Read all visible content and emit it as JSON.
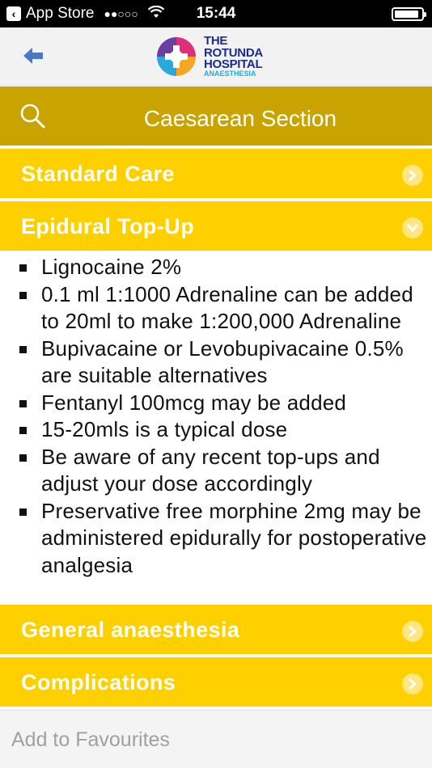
{
  "status_bar": {
    "back_app": "App Store",
    "signal": "●●○○○",
    "time": "15:44",
    "battery_level": 0.9
  },
  "nav": {
    "logo_line1": "THE",
    "logo_line2": "ROTUNDA",
    "logo_line3": "HOSPITAL",
    "logo_sub": "ANAESTHESIA"
  },
  "header": {
    "title": "Caesarean Section"
  },
  "sections": [
    {
      "title": "Standard Care",
      "expanded": false
    },
    {
      "title": "Epidural Top-Up",
      "expanded": true
    },
    {
      "title": "General anaesthesia",
      "expanded": false
    },
    {
      "title": "Complications",
      "expanded": false
    }
  ],
  "epidural_items": [
    "Lignocaine 2%",
    "0.1 ml 1:1000 Adrenaline can be added to 20ml to make 1:200,000 Adrenaline",
    "Bupivacaine or Levobupivacaine 0.5% are suitable alternatives",
    "Fentanyl 100mcg may be added",
    "15-20mls is a typical dose",
    "Be aware of any recent top-ups and adjust your dose accordingly",
    "Preservative free morphine 2mg may be administered epidurally for postoperative analgesia"
  ],
  "footer": {
    "favourites_label": "Add to Favourites"
  },
  "colors": {
    "header_gold": "#c9a300",
    "section_yellow": "#ffd000",
    "back_arrow_blue": "#4a78c8"
  }
}
